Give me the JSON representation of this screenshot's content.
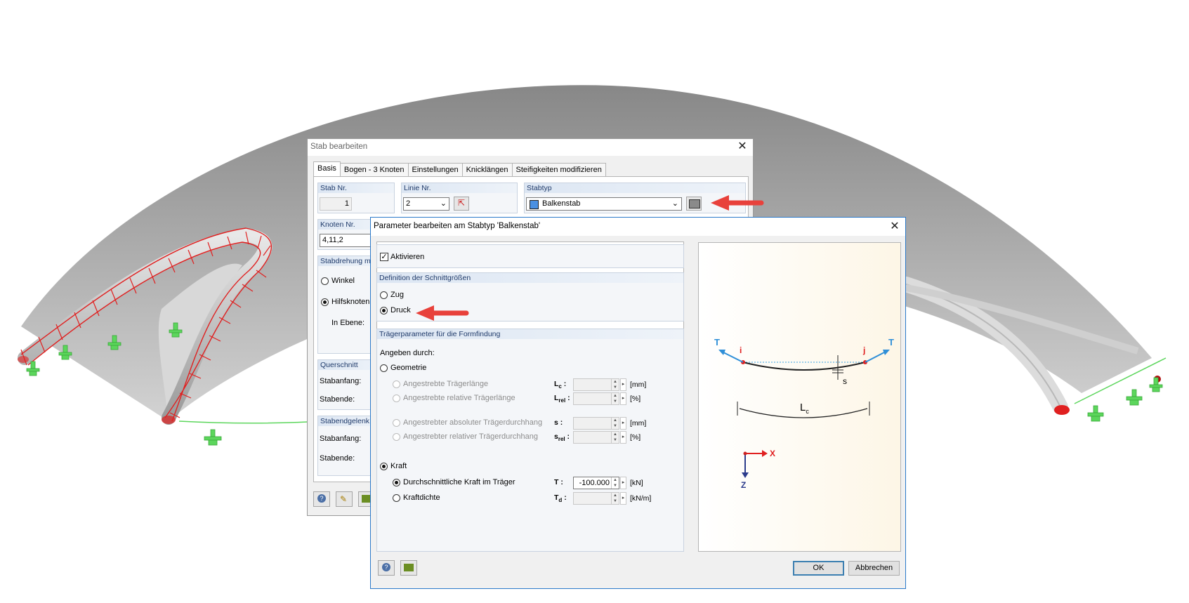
{
  "stab_dialog": {
    "title": "Stab bearbeiten",
    "tabs": [
      "Basis",
      "Bogen - 3 Knoten",
      "Einstellungen",
      "Knicklängen",
      "Steifigkeiten modifizieren"
    ],
    "stab_nr": {
      "label": "Stab Nr.",
      "value": "1"
    },
    "linie_nr": {
      "label": "Linie Nr.",
      "value": "2"
    },
    "stabtyp": {
      "label": "Stabtyp",
      "value": "Balkenstab"
    },
    "knoten_nr": {
      "label": "Knoten Nr.",
      "value": "4,11,2"
    },
    "stabdrehung": {
      "label": "Stabdrehung mit",
      "winkel": "Winkel",
      "hilfsknoten": "Hilfsknoten",
      "in_ebene": "In Ebene:"
    },
    "querschnitt": {
      "label": "Querschnitt",
      "stabanfang": "Stabanfang:",
      "stabende": "Stabende:"
    },
    "stabendgelenk": {
      "label": "Stabendgelenk",
      "stabanfang": "Stabanfang:",
      "stabende": "Stabende:"
    }
  },
  "param_dialog": {
    "title": "Parameter bearbeiten am Stabtyp  'Balkenstab'",
    "aktivieren": "Aktivieren",
    "definition": {
      "label": "Definition der Schnittgrößen",
      "zug": "Zug",
      "druck": "Druck"
    },
    "traeger": {
      "label": "Trägerparameter für die Formfindung",
      "angeben": "Angeben durch:",
      "geometrie": "Geometrie",
      "rows": [
        {
          "label": "Angestrebte Trägerlänge",
          "sym": "L",
          "sub": "c",
          "unit": "[mm]",
          "value": ""
        },
        {
          "label": "Angestrebte relative Trägerlänge",
          "sym": "L",
          "sub": "rel",
          "unit": "[%]",
          "value": ""
        },
        {
          "label": "Angestrebter absoluter Trägerdurchhang",
          "sym": "s",
          "sub": "",
          "unit": "[mm]",
          "value": ""
        },
        {
          "label": "Angestrebter relativer Trägerdurchhang",
          "sym": "s",
          "sub": "rel",
          "unit": "[%]",
          "value": ""
        }
      ],
      "kraft": "Kraft",
      "kraft_rows": [
        {
          "label": "Durchschnittliche Kraft im Träger",
          "sym": "T",
          "sub": "",
          "unit": "[kN]",
          "value": "-100.000"
        },
        {
          "label": "Kraftdichte",
          "sym": "T",
          "sub": "d",
          "unit": "[kN/m]",
          "value": ""
        }
      ]
    },
    "diagram": {
      "t_left": "T",
      "t_right": "T",
      "i": "i",
      "j": "j",
      "s": "s",
      "lc": "L",
      "lc_sub": "c",
      "x": "X",
      "z": "Z"
    },
    "buttons": {
      "ok": "OK",
      "cancel": "Abbrechen"
    }
  },
  "colors": {
    "accent_arrow": "#e8413b",
    "support_green": "#5cd65c",
    "member_red": "#e02020"
  }
}
